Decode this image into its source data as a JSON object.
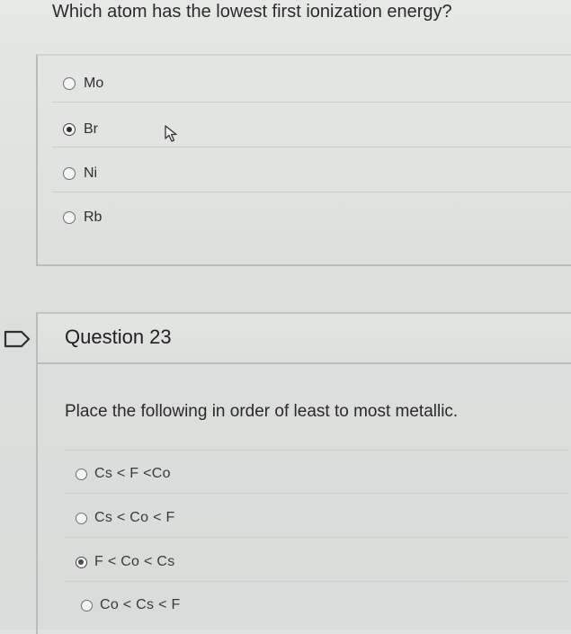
{
  "question_22": {
    "prompt": "Which atom has the lowest first ionization energy?",
    "options": [
      {
        "label": "Mo",
        "selected": false
      },
      {
        "label": "Br",
        "selected": true
      },
      {
        "label": "Ni",
        "selected": false
      },
      {
        "label": "Rb",
        "selected": false
      }
    ]
  },
  "question_23": {
    "title": "Question 23",
    "prompt": "Place the following in order of least to most metallic.",
    "options": [
      {
        "label": "Cs < F <Co",
        "selected": false
      },
      {
        "label": "Cs < Co < F",
        "selected": false
      },
      {
        "label": "F < Co < Cs",
        "selected": true
      },
      {
        "label": "Co < Cs < F",
        "selected": false
      }
    ]
  },
  "colors": {
    "background": "#dfe2e0",
    "text": "#222222",
    "border": "#b9bcba"
  },
  "icons": {
    "cursor": "mouse-pointer-icon",
    "flag": "question-flag-icon"
  }
}
